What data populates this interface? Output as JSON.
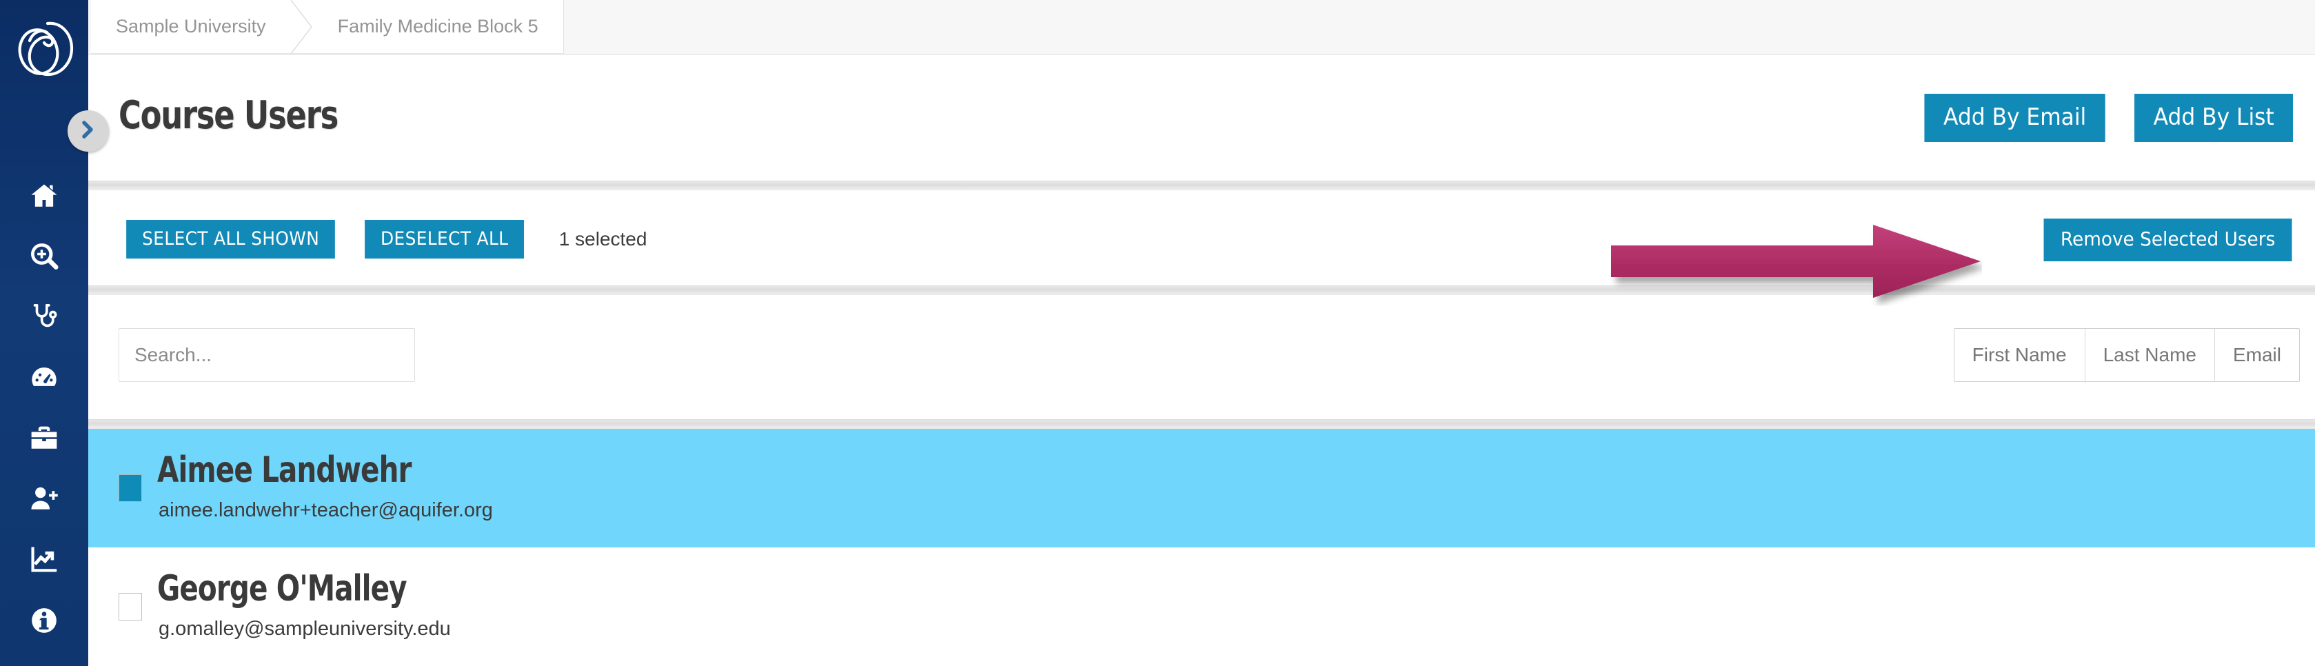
{
  "brand": {
    "logo_name": "aquifer-logo",
    "sidebar_color": "#0f366e",
    "accent_color": "#128ab7",
    "selected_row_color": "#71d6fb",
    "callout_arrow_color": "#b12e68"
  },
  "sidebar": {
    "toggle": {
      "name": "expand-sidebar-toggle",
      "icon": "chevron-right-icon"
    },
    "items": [
      {
        "icon": "home-icon",
        "label": "Home"
      },
      {
        "icon": "search-plus-icon",
        "label": "Search"
      },
      {
        "icon": "stethoscope-icon",
        "label": "Cases"
      },
      {
        "icon": "gauge-icon",
        "label": "Dashboard"
      },
      {
        "icon": "briefcase-icon",
        "label": "Courses"
      },
      {
        "icon": "user-plus-icon",
        "label": "Users"
      },
      {
        "icon": "chart-line-icon",
        "label": "Reports"
      },
      {
        "icon": "info-circle-icon",
        "label": "Info"
      }
    ]
  },
  "breadcrumb": {
    "items": [
      {
        "label": "Sample University"
      },
      {
        "label": "Family Medicine Block 5"
      }
    ]
  },
  "header": {
    "title": "Course Users",
    "actions": [
      {
        "label": "Add By Email",
        "name": "add-by-email-button"
      },
      {
        "label": "Add By List",
        "name": "add-by-list-button"
      }
    ]
  },
  "selection_toolbar": {
    "select_all_label": "SELECT ALL SHOWN",
    "deselect_all_label": "DESELECT ALL",
    "selected_count_text": "1 selected",
    "remove_label": "Remove Selected Users"
  },
  "search": {
    "value": "",
    "placeholder": "Search..."
  },
  "sort": {
    "options": [
      {
        "label": "First Name"
      },
      {
        "label": "Last Name"
      },
      {
        "label": "Email"
      }
    ]
  },
  "users": [
    {
      "name": "Aimee Landwehr",
      "email": "aimee.landwehr+teacher@aquifer.org",
      "selected": true
    },
    {
      "name": "George O'Malley",
      "email": "g.omalley@sampleuniversity.edu",
      "selected": false
    }
  ]
}
